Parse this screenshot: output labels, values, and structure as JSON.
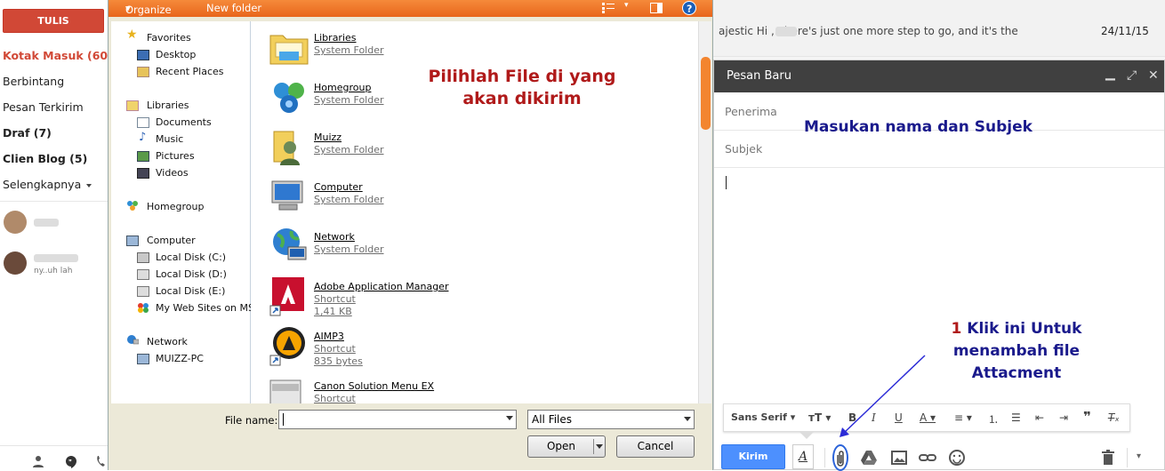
{
  "gmail_nav": {
    "compose_label": "TULIS",
    "items": [
      {
        "label": "Kotak Masuk (60)"
      },
      {
        "label": "Berbintang"
      },
      {
        "label": "Pesan Terkirim"
      },
      {
        "label": "Draf (7)"
      },
      {
        "label": "Clien Blog (5)"
      },
      {
        "label": "Selengkapnya"
      }
    ],
    "chat_snippet": "ny..uh lah"
  },
  "file_dialog": {
    "toolbar": {
      "organize": "Organize",
      "new_folder": "New folder"
    },
    "tree": {
      "favorites": "Favorites",
      "desktop": "Desktop",
      "recent": "Recent Places",
      "libraries": "Libraries",
      "documents": "Documents",
      "music": "Music",
      "pictures": "Pictures",
      "videos": "Videos",
      "homegroup": "Homegroup",
      "computer": "Computer",
      "disk_c": "Local Disk (C:)",
      "disk_d": "Local Disk (D:)",
      "disk_e": "Local Disk (E:)",
      "mywebsites": "My Web Sites on MS",
      "network": "Network",
      "muizz_pc": "MUIZZ-PC"
    },
    "files": [
      {
        "name": "Libraries",
        "sub1": "System Folder",
        "sub2": ""
      },
      {
        "name": "Homegroup",
        "sub1": "System Folder",
        "sub2": ""
      },
      {
        "name": "Muizz",
        "sub1": "System Folder",
        "sub2": ""
      },
      {
        "name": "Computer",
        "sub1": "System Folder",
        "sub2": ""
      },
      {
        "name": "Network",
        "sub1": "System Folder",
        "sub2": ""
      },
      {
        "name": "Adobe Application Manager",
        "sub1": "Shortcut",
        "sub2": "1,41 KB"
      },
      {
        "name": "AIMP3",
        "sub1": "Shortcut",
        "sub2": "835 bytes"
      },
      {
        "name": "Canon Solution Menu EX",
        "sub1": "Shortcut",
        "sub2": ""
      }
    ],
    "annotation_line1": "Pilihlah File di yang",
    "annotation_line2": "akan dikirim",
    "file_name_label": "File name:",
    "file_name_value": "",
    "file_type": "All Files",
    "open_label": "Open",
    "cancel_label": "Cancel"
  },
  "mail": {
    "snippet": "ajestic Hi        , There's just one more step to go, and it's the",
    "date": "24/11/15"
  },
  "compose": {
    "title": "Pesan Baru",
    "to_placeholder": "Penerima",
    "subject_placeholder": "Subjek",
    "annotation_subject": "Masukan nama dan Subjek",
    "annotation_num": "1",
    "annotation_attach_1": "Klik ini Untuk",
    "annotation_attach_2": "menambah file",
    "annotation_attach_3": "Attacment",
    "font_label": "Sans Serif",
    "send_label": "Kirim"
  },
  "colors": {
    "gmail_red": "#d14836",
    "dialog_orange": "#f07a2c",
    "send_blue": "#4d90fe",
    "annotation_red": "#b01a1a",
    "annotation_blue": "#1a1a8c"
  }
}
